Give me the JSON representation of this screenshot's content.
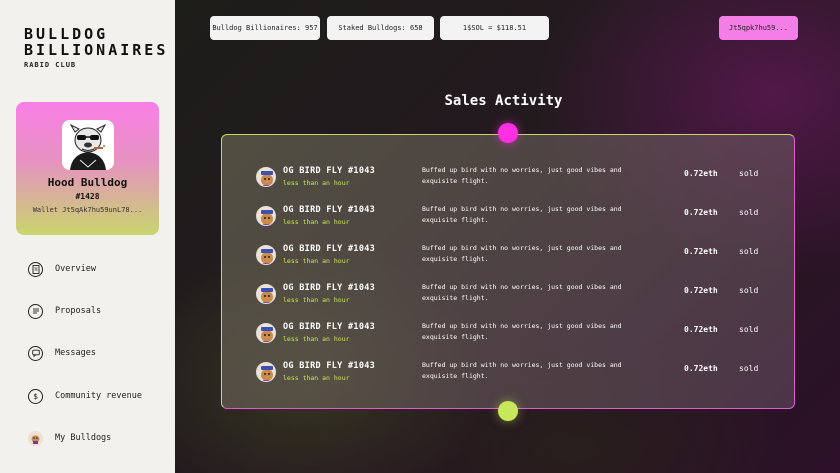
{
  "brand": {
    "line1": "BULLDOG",
    "line2": "BILLIONAIRES",
    "line3": "RABID CLUB"
  },
  "profile": {
    "name": "Hood Bulldog",
    "number": "#1428",
    "wallet": "Wallet Jt5qAk7hu59unL78..."
  },
  "nav": [
    {
      "label": "Overview",
      "icon": "document-icon"
    },
    {
      "label": "Proposals",
      "icon": "list-icon"
    },
    {
      "label": "Messages",
      "icon": "message-icon"
    },
    {
      "label": "Community revenue",
      "icon": "dollar-icon"
    },
    {
      "label": "My Bulldogs",
      "icon": "bulldog-icon"
    }
  ],
  "stats": {
    "billionaires": "Bulldog Billionaires: 957",
    "staked": "Staked Bulldogs: 658",
    "sol": "1$SOL = $118.51"
  },
  "wallet_button": "Jt5qpk7hu59...",
  "title": "Sales Activity",
  "sales": [
    {
      "name": "OG BIRD FLY #1043",
      "time": "less than an hour",
      "desc": "Buffed up bird with no worries, just good vibes and exquisite flight.",
      "price": "0.72eth",
      "status": "sold"
    },
    {
      "name": "OG BIRD FLY #1043",
      "time": "less than an hour",
      "desc": "Buffed up bird with no worries, just good vibes and exquisite flight.",
      "price": "0.72eth",
      "status": "sold"
    },
    {
      "name": "OG BIRD FLY #1043",
      "time": "less than an hour",
      "desc": "Buffed up bird with no worries, just good vibes and exquisite flight.",
      "price": "0.72eth",
      "status": "sold"
    },
    {
      "name": "OG BIRD FLY #1043",
      "time": "less than an hour",
      "desc": "Buffed up bird with no worries, just good vibes and exquisite flight.",
      "price": "0.72eth",
      "status": "sold"
    },
    {
      "name": "OG BIRD FLY #1043",
      "time": "less than an hour",
      "desc": "Buffed up bird with no worries, just good vibes and exquisite flight.",
      "price": "0.72eth",
      "status": "sold"
    },
    {
      "name": "OG BIRD FLY #1043",
      "time": "less than an hour",
      "desc": "Buffed up bird with no worries, just good vibes and exquisite flight.",
      "price": "0.72eth",
      "status": "sold"
    }
  ]
}
